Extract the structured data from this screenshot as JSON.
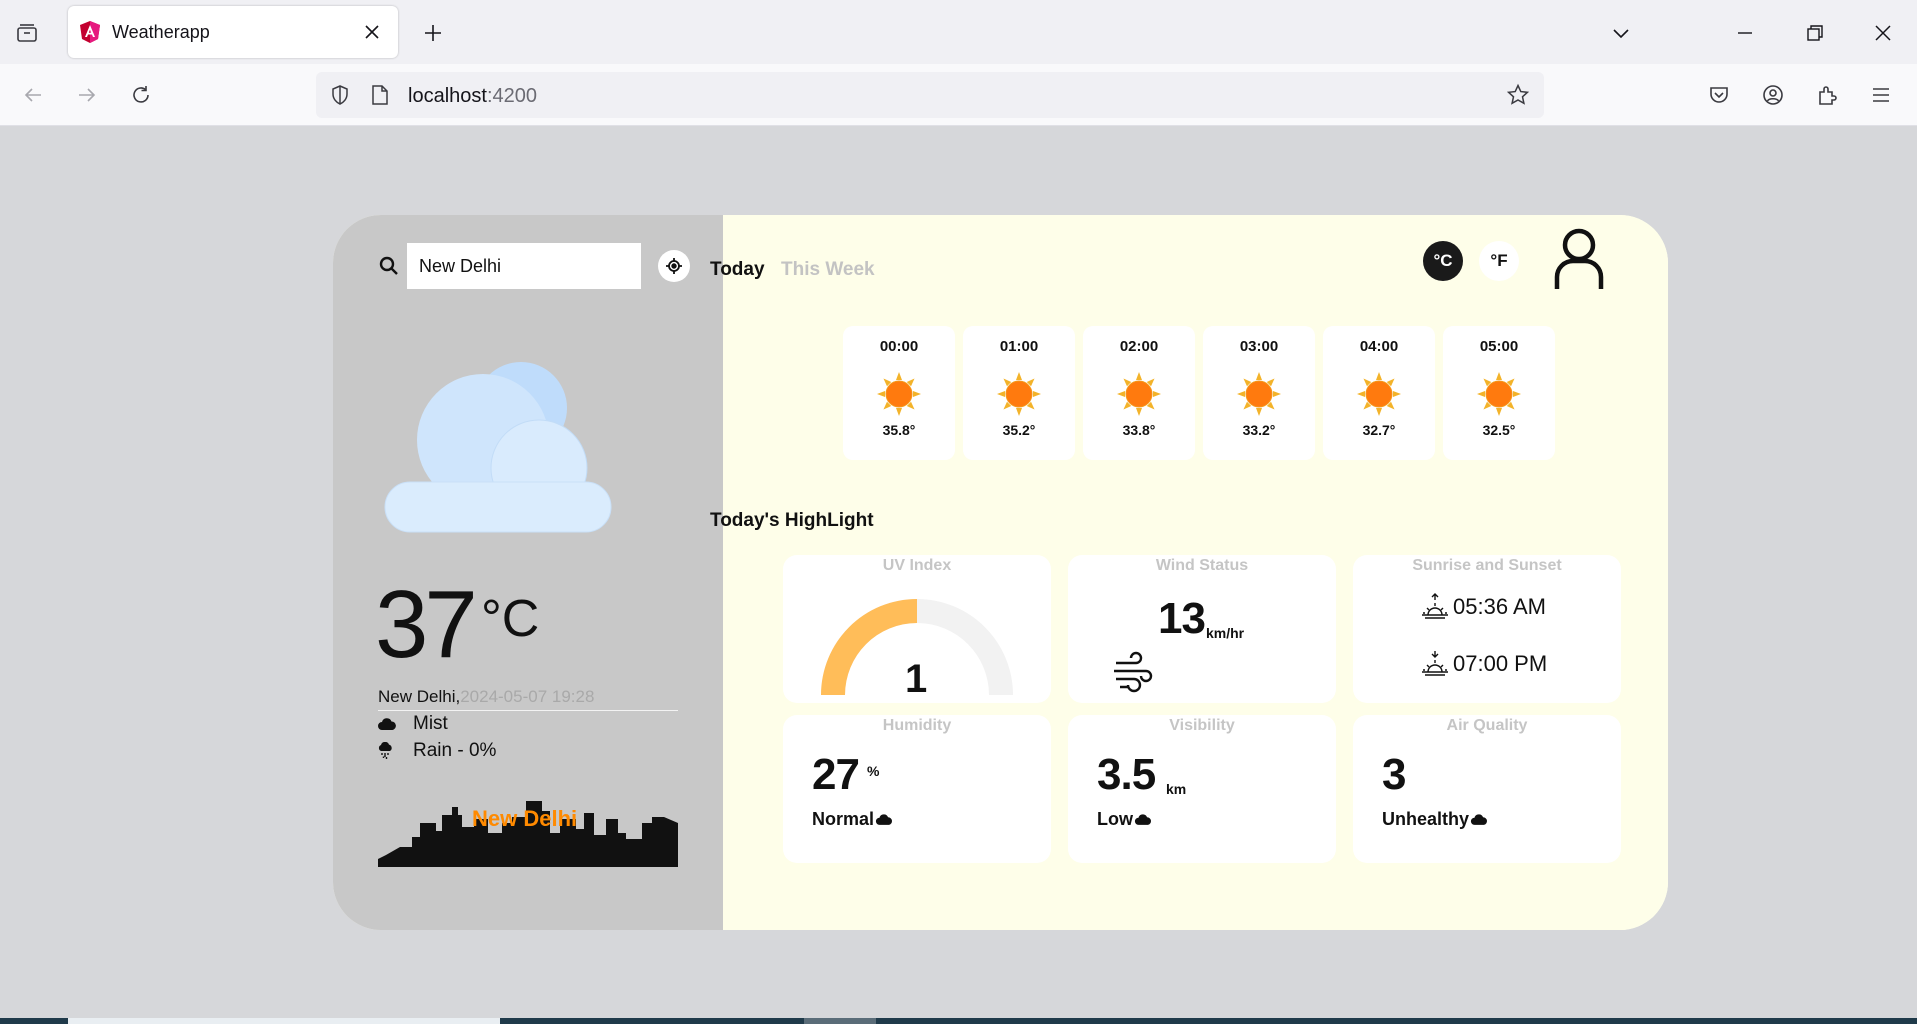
{
  "browser": {
    "tab_title": "Weatherapp",
    "url_host": "localhost",
    "url_port": ":4200"
  },
  "search": {
    "value": "New Delhi",
    "placeholder": ""
  },
  "current": {
    "temp": "37",
    "unit": "°C",
    "city": "New Delhi,",
    "datetime": "2024-05-07 19:28",
    "condition": "Mist",
    "rain": "Rain - 0%",
    "skyline_label": "New Delhi"
  },
  "tabs": {
    "today": "Today",
    "week": "This Week"
  },
  "units": {
    "celsius": "°C",
    "fahrenheit": "°F"
  },
  "hourly": [
    {
      "time": "00:00",
      "temp": "35.8°"
    },
    {
      "time": "01:00",
      "temp": "35.2°"
    },
    {
      "time": "02:00",
      "temp": "33.8°"
    },
    {
      "time": "03:00",
      "temp": "33.2°"
    },
    {
      "time": "04:00",
      "temp": "32.7°"
    },
    {
      "time": "05:00",
      "temp": "32.5°"
    }
  ],
  "highlights": {
    "title": "Today's HighLight",
    "uv": {
      "label": "UV Index",
      "value": "1",
      "fill_fraction": 0.5
    },
    "wind": {
      "label": "Wind Status",
      "value": "13",
      "unit": "km/hr"
    },
    "sun": {
      "label": "Sunrise and Sunset",
      "sunrise": "05:36 AM",
      "sunset": "07:00 PM"
    },
    "humidity": {
      "label": "Humidity",
      "value": "27",
      "unit": "%",
      "status": "Normal"
    },
    "visibility": {
      "label": "Visibility",
      "value": "3.5",
      "unit": "km",
      "status": "Low"
    },
    "air": {
      "label": "Air Quality",
      "value": "3",
      "status": "Unhealthy"
    }
  },
  "colors": {
    "left_panel": "#c8c8c8",
    "right_panel": "#fefee9",
    "accent_orange": "#ff8a00",
    "uv_gauge": "#ffbd59"
  }
}
